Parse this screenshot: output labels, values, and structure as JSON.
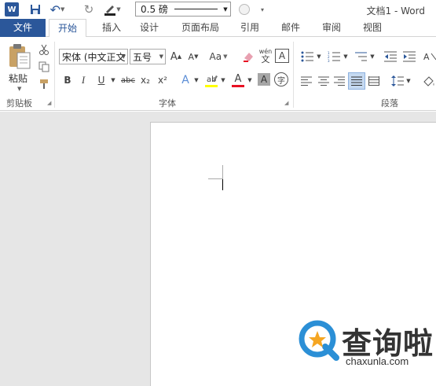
{
  "title_bar": {
    "app_logo": "W",
    "window_title": "文档1 - Word",
    "line_weight": "0.5 磅",
    "icons": [
      "word-logo",
      "save-icon",
      "undo-icon",
      "redo-icon",
      "pen-color-icon",
      "shape-effects-icon",
      "customize-quick-access-icon"
    ]
  },
  "tabs": [
    "文件",
    "开始",
    "插入",
    "设计",
    "页面布局",
    "引用",
    "邮件",
    "审阅",
    "视图"
  ],
  "active_tab": "开始",
  "ribbon": {
    "clipboard": {
      "paste_label": "粘贴",
      "group_label": "剪贴板"
    },
    "font": {
      "font_name": "宋体 (中文正文",
      "font_size": "五号",
      "group_label": "字体",
      "phonetic_top": "wén",
      "phonetic_char": "文",
      "border_char": "A",
      "grow": "A",
      "shrink": "A",
      "change_case": "Aa",
      "bold": "B",
      "italic": "I",
      "underline": "U",
      "strike": "abc",
      "subscript": "x₂",
      "superscript": "x²",
      "effect": "A",
      "font_color": "A",
      "shade": "A",
      "enclose": "字"
    },
    "paragraph": {
      "group_label": "段落"
    }
  },
  "colors": {
    "accent": "#2b579a",
    "highlight": "#ffff00",
    "font_color_bar": "#e81123",
    "selected_button": "#c5d9f1"
  },
  "watermark": {
    "brand": "查询啦",
    "url": "chaxunla.com"
  }
}
